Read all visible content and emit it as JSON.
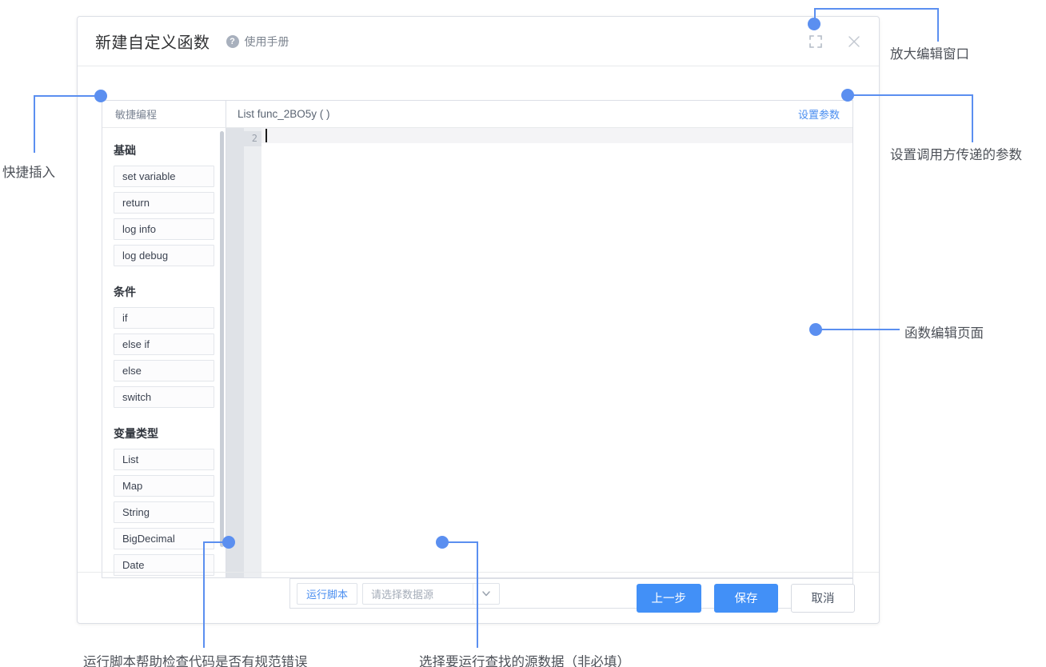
{
  "dialog": {
    "title": "新建自定义函数",
    "manual_link": "使用手册",
    "help_icon": "question-mark-icon",
    "expand_icon": "expand-fullscreen-icon",
    "close_icon": "close-x-icon"
  },
  "palette": {
    "tab_label": "敏捷编程",
    "groups": [
      {
        "title": "基础",
        "items": [
          "set variable",
          "return",
          "log info",
          "log debug"
        ]
      },
      {
        "title": "条件",
        "items": [
          "if",
          "else if",
          "else",
          "switch"
        ]
      },
      {
        "title": "变量类型",
        "items": [
          "List",
          "Map",
          "String",
          "BigDecimal",
          "Date"
        ]
      }
    ]
  },
  "editor": {
    "signature": "List func_2BO5y ( )",
    "params_link": "设置参数",
    "line_number": "2",
    "code": ""
  },
  "run_bar": {
    "run_label": "运行脚本",
    "datasource_placeholder": "请选择数据源",
    "datasource_value": "",
    "dropdown_icon": "chevron-down-icon",
    "collapse_icon": "chevron-up-icon"
  },
  "footer": {
    "prev_label": "上一步",
    "save_label": "保存",
    "cancel_label": "取消"
  },
  "annotations": {
    "expand": "放大编辑窗口",
    "params": "设置调用方传递的参数",
    "editor_page": "函数编辑页面",
    "quick_insert": "快捷插入",
    "run_script": "运行脚本帮助检查代码是否有规范错误",
    "datasource": "选择要运行查找的源数据（非必填）"
  },
  "colors": {
    "accent": "#4290f7",
    "callout": "#5b8ff0",
    "link": "#4a8ef0"
  }
}
